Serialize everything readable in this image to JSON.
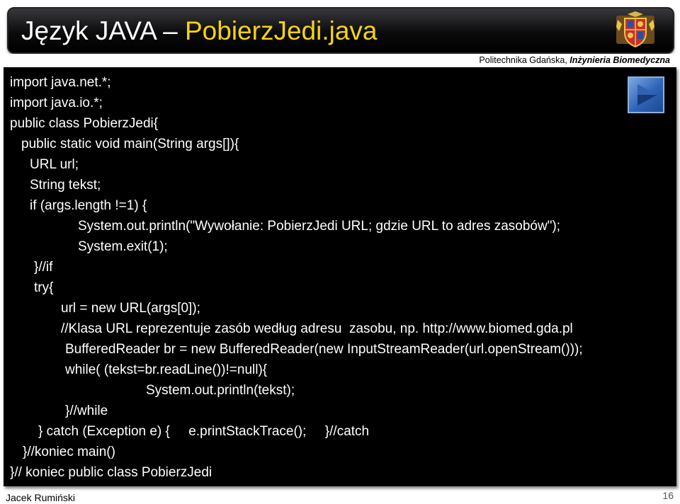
{
  "header": {
    "title_plain": "Język JAVA – ",
    "title_highlight": "PobierzJedi.java",
    "institution_plain": "Politechnika Gdańska, ",
    "institution_emphasis": "Inżynieria Biomedyczna",
    "emblem_icon": "university-crest-icon"
  },
  "navigation": {
    "next_icon": "play-arrow-icon"
  },
  "code": {
    "lines": [
      "import java.net.*;",
      "import java.io.*;",
      "public class PobierzJedi{",
      "public static void main(String args[]){",
      "URL url;",
      "String tekst;",
      "if (args.length !=1) {",
      "System.out.println(\"Wywołanie: PobierzJedi URL; gdzie URL to adres zasobów\");",
      "System.exit(1);",
      "}//if",
      "try{",
      "url = new URL(args[0]);",
      "//Klasa URL reprezentuje zasób według adresu  zasobu, np. http://www.biomed.gda.pl",
      "BufferedReader br = new BufferedReader(new InputStreamReader(url.openStream()));",
      "while( (tekst=br.readLine())!=null){",
      "System.out.println(tekst);",
      "}//while",
      "} catch (Exception e) {     e.printStackTrace();     }//catch",
      "}//koniec main()",
      "}// koniec public class PobierzJedi"
    ]
  },
  "footer": {
    "author": "Jacek Rumiński",
    "page_number": "16"
  },
  "colors": {
    "title_white": "#ffffff",
    "title_yellow": "#f5d312",
    "code_background": "#000000",
    "code_text": "#ffffff",
    "button_blue": "#2e63b8"
  }
}
